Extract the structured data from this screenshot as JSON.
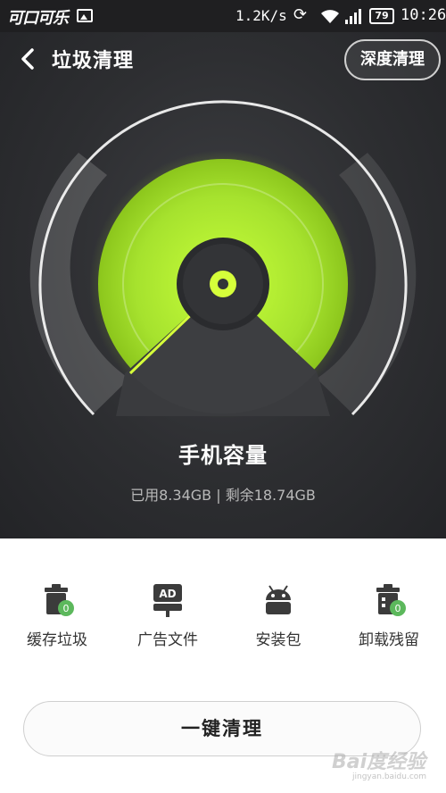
{
  "status_bar": {
    "carrier": "可口可乐",
    "speed": "1.2K/s",
    "battery": "79",
    "time": "10:26"
  },
  "header": {
    "title": "垃圾清理",
    "deep_clean_label": "深度清理"
  },
  "gauge": {
    "title": "手机容量",
    "info": "已用8.34GB | 剩余18.74GB",
    "used_gb": 8.34,
    "free_gb": 18.74,
    "accent_color": "#a6e22e"
  },
  "categories": [
    {
      "label": "缓存垃圾",
      "icon": "trash-can-icon",
      "badge": "0"
    },
    {
      "label": "广告文件",
      "icon": "ad-sign-icon",
      "badge": ""
    },
    {
      "label": "安装包",
      "icon": "android-icon",
      "badge": ""
    },
    {
      "label": "卸载残留",
      "icon": "uninstall-trash-icon",
      "badge": "0"
    }
  ],
  "actions": {
    "one_key_clean": "一键清理"
  },
  "watermark": {
    "text": "Bai度经验",
    "sub": "jingyan.baidu.com"
  }
}
